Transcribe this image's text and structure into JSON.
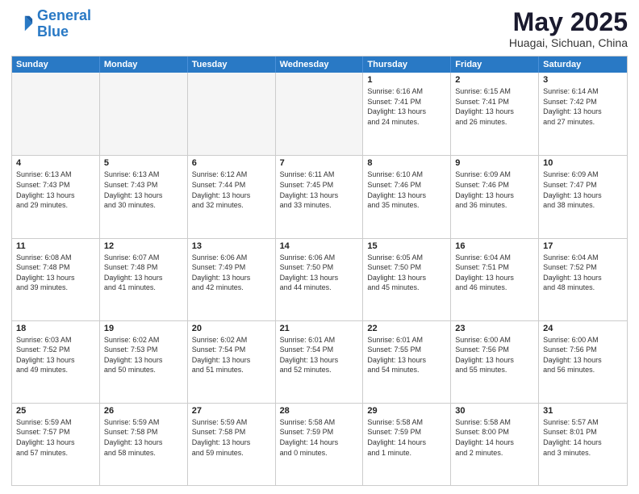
{
  "header": {
    "logo_line1": "General",
    "logo_line2": "Blue",
    "month": "May 2025",
    "location": "Huagai, Sichuan, China"
  },
  "weekdays": [
    "Sunday",
    "Monday",
    "Tuesday",
    "Wednesday",
    "Thursday",
    "Friday",
    "Saturday"
  ],
  "weeks": [
    [
      {
        "day": "",
        "empty": true
      },
      {
        "day": "",
        "empty": true
      },
      {
        "day": "",
        "empty": true
      },
      {
        "day": "",
        "empty": true
      },
      {
        "day": "1",
        "info": "Sunrise: 6:16 AM\nSunset: 7:41 PM\nDaylight: 13 hours\nand 24 minutes."
      },
      {
        "day": "2",
        "info": "Sunrise: 6:15 AM\nSunset: 7:41 PM\nDaylight: 13 hours\nand 26 minutes."
      },
      {
        "day": "3",
        "info": "Sunrise: 6:14 AM\nSunset: 7:42 PM\nDaylight: 13 hours\nand 27 minutes."
      }
    ],
    [
      {
        "day": "4",
        "info": "Sunrise: 6:13 AM\nSunset: 7:43 PM\nDaylight: 13 hours\nand 29 minutes."
      },
      {
        "day": "5",
        "info": "Sunrise: 6:13 AM\nSunset: 7:43 PM\nDaylight: 13 hours\nand 30 minutes."
      },
      {
        "day": "6",
        "info": "Sunrise: 6:12 AM\nSunset: 7:44 PM\nDaylight: 13 hours\nand 32 minutes."
      },
      {
        "day": "7",
        "info": "Sunrise: 6:11 AM\nSunset: 7:45 PM\nDaylight: 13 hours\nand 33 minutes."
      },
      {
        "day": "8",
        "info": "Sunrise: 6:10 AM\nSunset: 7:46 PM\nDaylight: 13 hours\nand 35 minutes."
      },
      {
        "day": "9",
        "info": "Sunrise: 6:09 AM\nSunset: 7:46 PM\nDaylight: 13 hours\nand 36 minutes."
      },
      {
        "day": "10",
        "info": "Sunrise: 6:09 AM\nSunset: 7:47 PM\nDaylight: 13 hours\nand 38 minutes."
      }
    ],
    [
      {
        "day": "11",
        "info": "Sunrise: 6:08 AM\nSunset: 7:48 PM\nDaylight: 13 hours\nand 39 minutes."
      },
      {
        "day": "12",
        "info": "Sunrise: 6:07 AM\nSunset: 7:48 PM\nDaylight: 13 hours\nand 41 minutes."
      },
      {
        "day": "13",
        "info": "Sunrise: 6:06 AM\nSunset: 7:49 PM\nDaylight: 13 hours\nand 42 minutes."
      },
      {
        "day": "14",
        "info": "Sunrise: 6:06 AM\nSunset: 7:50 PM\nDaylight: 13 hours\nand 44 minutes."
      },
      {
        "day": "15",
        "info": "Sunrise: 6:05 AM\nSunset: 7:50 PM\nDaylight: 13 hours\nand 45 minutes."
      },
      {
        "day": "16",
        "info": "Sunrise: 6:04 AM\nSunset: 7:51 PM\nDaylight: 13 hours\nand 46 minutes."
      },
      {
        "day": "17",
        "info": "Sunrise: 6:04 AM\nSunset: 7:52 PM\nDaylight: 13 hours\nand 48 minutes."
      }
    ],
    [
      {
        "day": "18",
        "info": "Sunrise: 6:03 AM\nSunset: 7:52 PM\nDaylight: 13 hours\nand 49 minutes."
      },
      {
        "day": "19",
        "info": "Sunrise: 6:02 AM\nSunset: 7:53 PM\nDaylight: 13 hours\nand 50 minutes."
      },
      {
        "day": "20",
        "info": "Sunrise: 6:02 AM\nSunset: 7:54 PM\nDaylight: 13 hours\nand 51 minutes."
      },
      {
        "day": "21",
        "info": "Sunrise: 6:01 AM\nSunset: 7:54 PM\nDaylight: 13 hours\nand 52 minutes."
      },
      {
        "day": "22",
        "info": "Sunrise: 6:01 AM\nSunset: 7:55 PM\nDaylight: 13 hours\nand 54 minutes."
      },
      {
        "day": "23",
        "info": "Sunrise: 6:00 AM\nSunset: 7:56 PM\nDaylight: 13 hours\nand 55 minutes."
      },
      {
        "day": "24",
        "info": "Sunrise: 6:00 AM\nSunset: 7:56 PM\nDaylight: 13 hours\nand 56 minutes."
      }
    ],
    [
      {
        "day": "25",
        "info": "Sunrise: 5:59 AM\nSunset: 7:57 PM\nDaylight: 13 hours\nand 57 minutes."
      },
      {
        "day": "26",
        "info": "Sunrise: 5:59 AM\nSunset: 7:58 PM\nDaylight: 13 hours\nand 58 minutes."
      },
      {
        "day": "27",
        "info": "Sunrise: 5:59 AM\nSunset: 7:58 PM\nDaylight: 13 hours\nand 59 minutes."
      },
      {
        "day": "28",
        "info": "Sunrise: 5:58 AM\nSunset: 7:59 PM\nDaylight: 14 hours\nand 0 minutes."
      },
      {
        "day": "29",
        "info": "Sunrise: 5:58 AM\nSunset: 7:59 PM\nDaylight: 14 hours\nand 1 minute."
      },
      {
        "day": "30",
        "info": "Sunrise: 5:58 AM\nSunset: 8:00 PM\nDaylight: 14 hours\nand 2 minutes."
      },
      {
        "day": "31",
        "info": "Sunrise: 5:57 AM\nSunset: 8:01 PM\nDaylight: 14 hours\nand 3 minutes."
      }
    ]
  ]
}
